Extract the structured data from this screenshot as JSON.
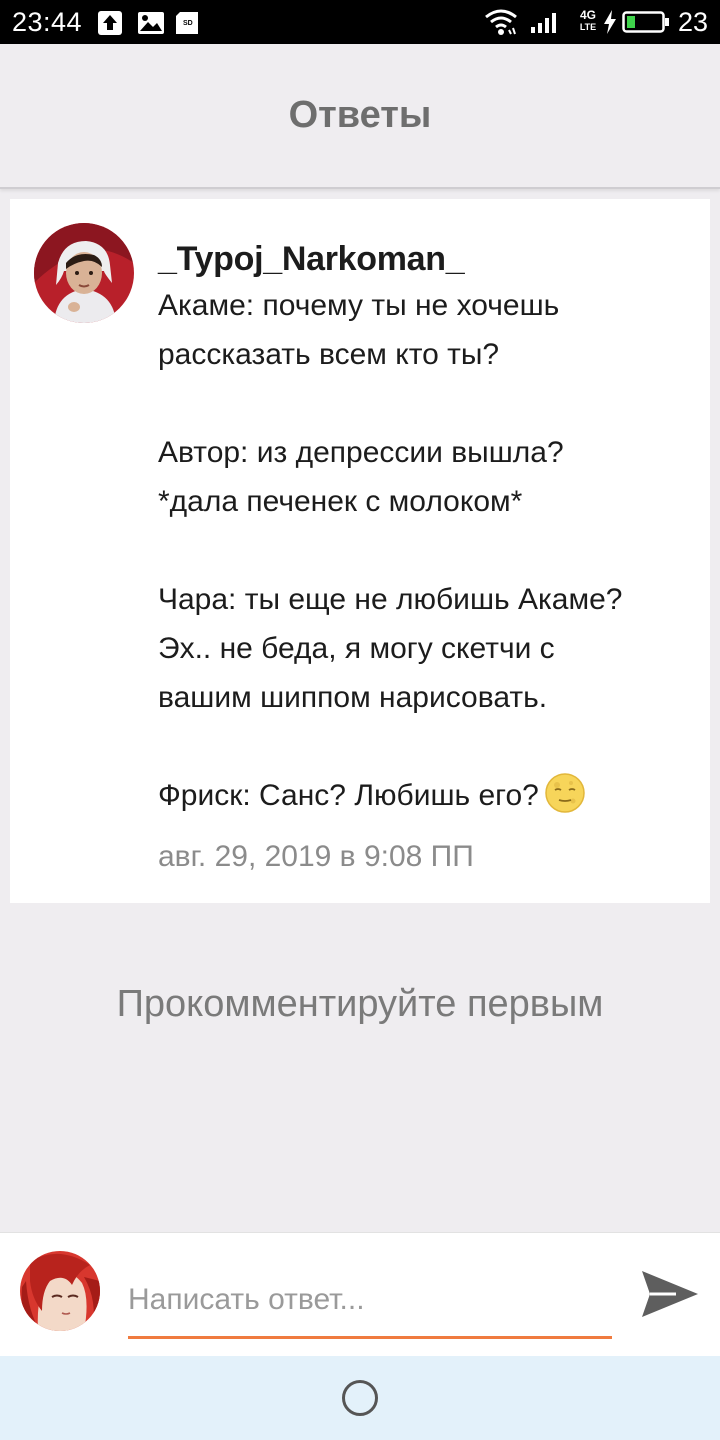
{
  "status_bar": {
    "time": "23:44",
    "icons_left": [
      "upload-icon",
      "image-icon",
      "sd-card-icon"
    ],
    "icons_right": [
      "wifi-icon",
      "signal-icon",
      "4g-lte-icon",
      "charging-bolt-icon",
      "battery-icon"
    ],
    "network_label": "4G",
    "network_sub": "LTE",
    "battery": "23",
    "battery_level": 0.23
  },
  "header": {
    "title": "Ответы"
  },
  "comment": {
    "avatar_icon": "user-avatar",
    "username": "_Typoj_Narkoman_",
    "lines": [
      "Акаме: почему ты не хочешь",
      "рассказать всем кто ты?",
      "",
      "Автор: из депрессии вышла?",
      "*дала печенек с молоком*",
      "",
      "Чара: ты еще не любишь Акаме?",
      "Эх.. не беда, я могу скетчи с",
      "вашим шиппом нарисовать.",
      "",
      "Фриск: Санс? Любишь его?"
    ],
    "trailing_emoji": "moon-face-emoji",
    "date": "авг. 29, 2019 в 9:08 ПП"
  },
  "empty_state": {
    "text": "Прокомментируйте первым"
  },
  "reply_bar": {
    "avatar_icon": "current-user-avatar",
    "placeholder": "Написать ответ...",
    "value": "",
    "send_icon": "send-icon",
    "accent_color": "#f07b3f"
  },
  "nav_bar": {
    "home_icon": "home-circle-icon",
    "background": "#e3f1fa"
  }
}
